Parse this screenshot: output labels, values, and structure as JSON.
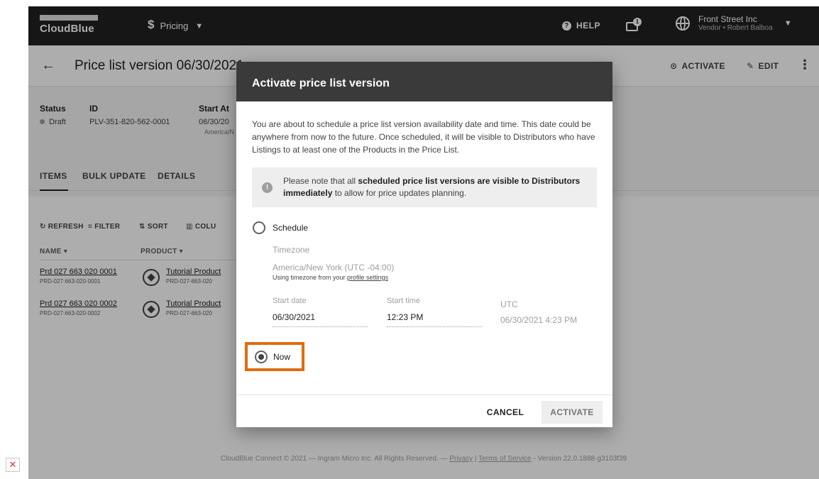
{
  "topbar": {
    "logo_text": "CloudBlue",
    "module_label": "Pricing",
    "help_label": "HELP",
    "notification_count": "1",
    "account_name": "Front Street Inc",
    "account_sub": "Vendor • Robert Balboa"
  },
  "header": {
    "title": "Price list version 06/30/2021",
    "activate_label": "ACTIVATE",
    "edit_label": "EDIT"
  },
  "details": {
    "status_label": "Status",
    "status_value": "Draft",
    "id_label": "ID",
    "id_value": "PLV-351-820-562-0001",
    "start_label": "Start At",
    "start_value": "06/30/20",
    "start_tz": "America/N"
  },
  "tabs": [
    "ITEMS",
    "BULK UPDATE",
    "DETAILS"
  ],
  "toolbar": [
    "REFRESH",
    "FILTER",
    "SORT",
    "COLU"
  ],
  "columns": [
    "NAME ▾",
    "PRODUCT ▾"
  ],
  "rows": [
    {
      "name": "Prd 027 663 020 0001",
      "id": "PRD-027-663-020-0001",
      "product": "Tutorial Product",
      "product_id": "PRD-027-663-020"
    },
    {
      "name": "Prd 027 663 020 0002",
      "id": "PRD-027-663-020-0002",
      "product": "Tutorial Product",
      "product_id": "PRD-027-663-020"
    }
  ],
  "footer": {
    "prefix": "CloudBlue Connect © 2021 — Ingram Micro Inc. All Rights Reserved. — ",
    "privacy": "Privacy",
    "sep": " | ",
    "terms": "Terms of Service",
    "version": " - Version 22.0.1888-g3103f39"
  },
  "dialog": {
    "title": "Activate price list version",
    "description": "You are about to schedule a price list version availability date and time. This date could be anywhere from now to the future. Once scheduled, it will be visible to Distributors who have Listings to at least one of the Products in the Price List.",
    "note_prefix": "Please note that all ",
    "note_bold1": "scheduled price list versions are visible to Distributors immediately",
    "note_suffix": " to allow for price updates planning.",
    "schedule_label": "Schedule",
    "timezone_label": "Timezone",
    "timezone_value": "America/New York (UTC -04:00)",
    "timezone_hint_prefix": "Using timezone from your ",
    "timezone_hint_link": "profile settings",
    "start_date_label": "Start date",
    "start_date_value": "06/30/2021",
    "start_time_label": "Start time",
    "start_time_value": "12:23 PM",
    "utc_label": "UTC",
    "utc_value": "06/30/2021 4:23 PM",
    "now_label": "Now",
    "cancel_label": "CANCEL",
    "activate_label": "ACTIVATE"
  }
}
